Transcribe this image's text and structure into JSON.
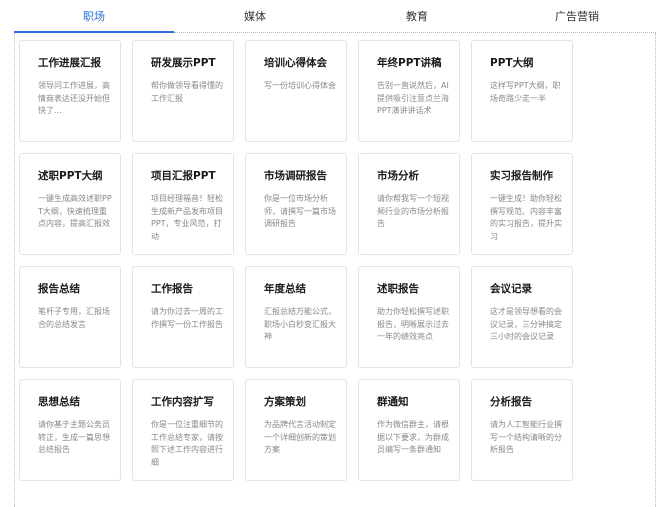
{
  "tabs": [
    {
      "label": "职场",
      "active": true
    },
    {
      "label": "媒体",
      "active": false
    },
    {
      "label": "教育",
      "active": false
    },
    {
      "label": "广告营销",
      "active": false
    }
  ],
  "accent_color": "#2f6fe0",
  "cards": [
    {
      "title": "工作进展汇报",
      "desc": "领导问工作进展，高情商表达还没开始但快了..."
    },
    {
      "title": "研发展示PPT",
      "desc": "帮你做领导看得懂的工作汇报"
    },
    {
      "title": "培训心得体会",
      "desc": "写一份培训心得体会"
    },
    {
      "title": "年终PPT讲稿",
      "desc": "告别一直说然后，AI提供吸引注意点兰海PPT演讲讲话术"
    },
    {
      "title": "PPT大纲",
      "desc": "这样写PPT大纲，职场奇路少走一半"
    },
    {
      "title": "述职PPT大纲",
      "desc": "一键生成高效述职PPT大纲，快速梳理重点内容，提高汇报效"
    },
    {
      "title": "项目汇报PPT",
      "desc": "项目经理福音！轻松生成新产品发布项目PPT，专业风范，打动"
    },
    {
      "title": "市场调研报告",
      "desc": "你是一位市场分析师，请撰写一篇市场调研报告"
    },
    {
      "title": "市场分析",
      "desc": "请你帮我写一个短视频行业的市场分析报告"
    },
    {
      "title": "实习报告制作",
      "desc": "一键生成！助你轻松撰写规范、内容丰富的实习报告，提升实习"
    },
    {
      "title": "报告总结",
      "desc": "笔杆子专用，汇报场合的总结发言"
    },
    {
      "title": "工作报告",
      "desc": "请为你过去一周的工作撰写一份工作报告"
    },
    {
      "title": "年度总结",
      "desc": "汇报总结万能公式，职场小白秒变汇报大神"
    },
    {
      "title": "述职报告",
      "desc": "助力你轻松撰写述职报告，明晰展示过去一年的绩效亮点"
    },
    {
      "title": "会议记录",
      "desc": "这才是领导想看的会议记录，三分钟搞定三小时的会议记录"
    },
    {
      "title": "思想总结",
      "desc": "请你基于主题公务员转正，生成一篇思想总结报告"
    },
    {
      "title": "工作内容扩写",
      "desc": "你是一位注重细节的工作总结专家，请按照下述工作内容进行细"
    },
    {
      "title": "方案策划",
      "desc": "为品牌代言活动制定一个详细创新的策划方案"
    },
    {
      "title": "群通知",
      "desc": "作为微信群主，请根据以下要求，为群成员编写一条群通知"
    },
    {
      "title": "分析报告",
      "desc": "请为人工智能行业撰写一个结构清晰的分析报告"
    }
  ]
}
